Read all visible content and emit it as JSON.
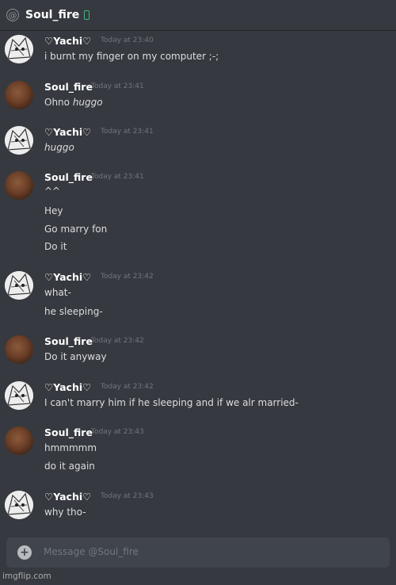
{
  "header": {
    "title": "Soul_fire",
    "at_icon": "@"
  },
  "messages": [
    {
      "author": "♡Yachi♡",
      "timestamp": "Today at 23:40",
      "lines": [
        "i burnt my finger on my computer ;-;"
      ]
    },
    {
      "author": "Soul_fire",
      "timestamp": "Today at 23:41",
      "lines": [
        "Ohno ",
        "huggo"
      ]
    },
    {
      "author": "♡Yachi♡",
      "timestamp": "Today at 23:41",
      "lines": [
        "huggo"
      ]
    },
    {
      "author": "Soul_fire",
      "timestamp": "Today at 23:41",
      "lines": [
        "^^",
        "Hey",
        "Go marry fon",
        "Do it"
      ]
    },
    {
      "author": "♡Yachi♡",
      "timestamp": "Today at 23:42",
      "lines": [
        "what-",
        "he sleeping-"
      ]
    },
    {
      "author": "Soul_fire",
      "timestamp": "Today at 23:42",
      "lines": [
        "Do it anyway"
      ]
    },
    {
      "author": "♡Yachi♡",
      "timestamp": "Today at 23:42",
      "lines": [
        "I can't marry him if he sleeping and if we alr married-"
      ]
    },
    {
      "author": "Soul_fire",
      "timestamp": "Today at 23:43",
      "lines": [
        "hmmmmm",
        "do it again"
      ]
    },
    {
      "author": "♡Yachi♡",
      "timestamp": "Today at 23:43",
      "lines": [
        "why tho-"
      ]
    }
  ],
  "composer": {
    "placeholder": "Message @Soul_fire",
    "plus": "+"
  },
  "watermark": "imgflip.com"
}
